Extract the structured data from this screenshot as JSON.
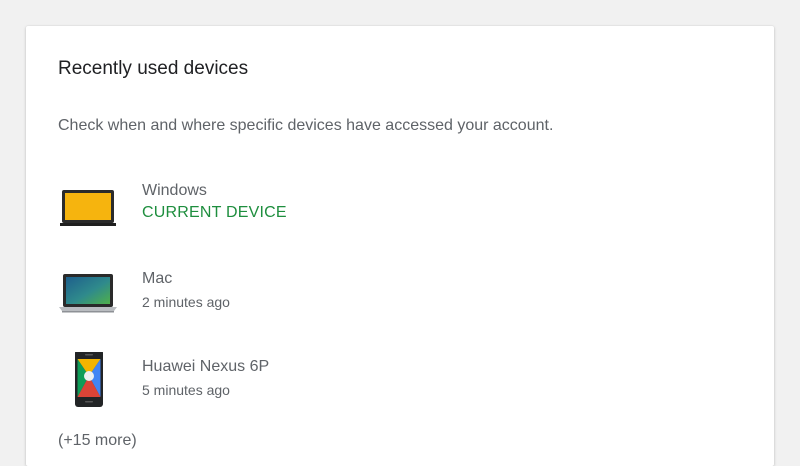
{
  "section": {
    "title": "Recently used devices",
    "description": "Check when and where specific devices have accessed your account."
  },
  "devices": [
    {
      "name": "Windows",
      "status": "CURRENT DEVICE",
      "icon": "windows-laptop-icon"
    },
    {
      "name": "Mac",
      "status": "2 minutes ago",
      "icon": "macbook-icon"
    },
    {
      "name": "Huawei Nexus 6P",
      "status": "5 minutes ago",
      "icon": "android-phone-icon"
    }
  ],
  "more_label": "(+15 more)",
  "colors": {
    "background": "#f1f1f1",
    "card": "#ffffff",
    "current_device": "#1e8e3e",
    "text_primary": "#202124",
    "text_secondary": "#5f6368"
  }
}
